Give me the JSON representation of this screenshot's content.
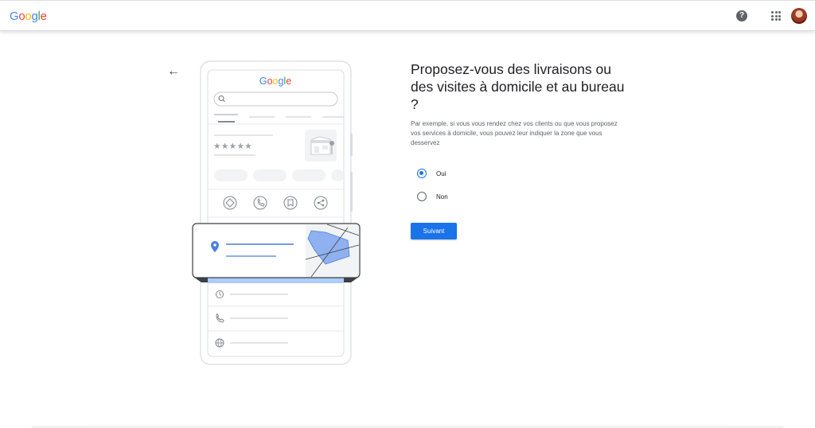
{
  "header": {
    "logo_letters": [
      {
        "char": "G",
        "color": "#4285F4"
      },
      {
        "char": "o",
        "color": "#EA4335"
      },
      {
        "char": "o",
        "color": "#FBBC05"
      },
      {
        "char": "g",
        "color": "#4285F4"
      },
      {
        "char": "l",
        "color": "#34A853"
      },
      {
        "char": "e",
        "color": "#EA4335"
      }
    ],
    "help_icon": "help-circle-icon",
    "help_glyph": "?",
    "apps_icon": "apps-grid-icon",
    "avatar_icon": "account-avatar"
  },
  "back_icon": "arrow-back-icon",
  "back_glyph": "←",
  "illustration": {
    "phone_logo": "Google",
    "rating_stars": "★★★★★",
    "action_icons": [
      "directions-icon",
      "phone-icon",
      "bookmark-icon",
      "share-icon"
    ],
    "info_icons": [
      "clock-icon",
      "phone-icon",
      "globe-icon"
    ]
  },
  "main": {
    "title": "Proposez-vous des livraisons ou des visites à domicile et au bureau ?",
    "description": "Par exemple, si vous vous rendez chez vos clients ou que vous proposez vos services à domicile, vous pouvez leur indiquer la zone que vous desservez",
    "options": [
      {
        "label": "Oui",
        "selected": true
      },
      {
        "label": "Non",
        "selected": false
      }
    ],
    "next_label": "Suivant"
  },
  "colors": {
    "accent": "#1a73e8",
    "map_fill": "#8fb1f0",
    "pin": "#4a7fdc"
  }
}
